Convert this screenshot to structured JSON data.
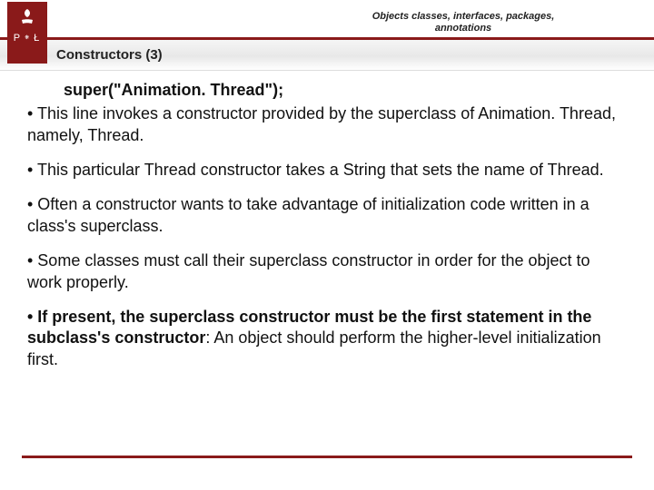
{
  "header": {
    "title_line1": "Objects classes, interfaces, packages,",
    "title_line2": "annotations",
    "logo_left": "P",
    "logo_right": "Ł"
  },
  "subheader": {
    "title": "Constructors (3)"
  },
  "content": {
    "code": "super(\"Animation. Thread\");",
    "bullet1": " • This line invokes a constructor provided by the superclass of Animation. Thread, namely, Thread.",
    "bullet2": " • This particular Thread constructor takes a String that sets the name of Thread.",
    "bullet3": " • Often a constructor wants to take advantage of initialization code written in a class's superclass.",
    "bullet4": " • Some classes must call their superclass constructor in order for the object to work properly.",
    "bullet5_bold": " • If present, the superclass constructor must be the first statement in the subclass's constructor",
    "bullet5_rest": ": An object should perform the higher-level initialization first."
  },
  "colors": {
    "brand": "#8a1a1a"
  }
}
